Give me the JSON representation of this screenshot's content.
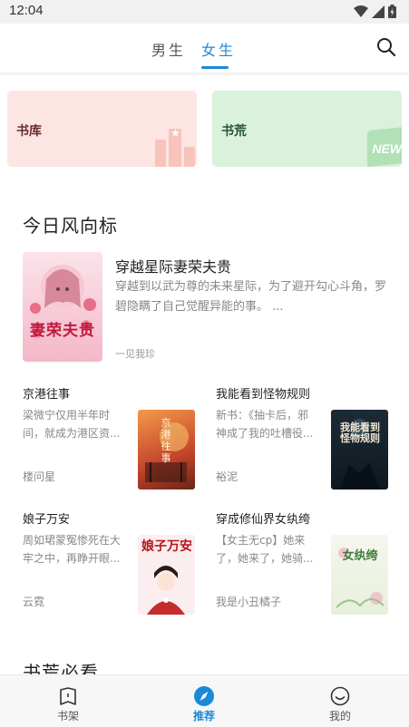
{
  "status_bar": {
    "time": "12:04"
  },
  "top_nav": {
    "tabs": [
      {
        "label": "男生",
        "active": false
      },
      {
        "label": "女生",
        "active": true
      }
    ],
    "accent_color": "#1a8ad8",
    "search_icon": "search-icon"
  },
  "categories": [
    {
      "label": "书库",
      "color": "#fde5e3"
    },
    {
      "label": "书荒",
      "color": "#daf1dc",
      "badge": "NEW"
    }
  ],
  "section_today": {
    "title": "今日风向标",
    "featured": {
      "title": "穿越星际妻荣夫贵",
      "description": "穿越到以武为尊的未来星际，为了避开勾心斗角，罗碧隐瞒了自己觉醒异能的事。 ...",
      "author": "一见我珍",
      "cover_text": "妻荣夫贵"
    },
    "books": [
      {
        "title": "京港往事",
        "description": "梁微宁仅用半年时间，就成为港区资...",
        "author": "楼问星",
        "cover_text": "京港往事"
      },
      {
        "title": "我能看到怪物规则",
        "description": "新书：《抽卡后，邪神成了我的吐槽役...",
        "author": "裕泥",
        "cover_text": "我能看到怪物规则"
      },
      {
        "title": "娘子万安",
        "description": "周如珺蒙冤惨死在大牢之中，再睁开眼...",
        "author": "云霓",
        "cover_text": "娘子万安"
      },
      {
        "title": "穿成修仙界女纨绔",
        "description": "【女主无cp】她来了，她来了，她骑...",
        "author": "我是小丑橘子",
        "cover_text": "女纨绔"
      }
    ]
  },
  "section_shortage": {
    "title": "书荒必看"
  },
  "bottom_nav": [
    {
      "label": "书架",
      "icon": "bookshelf-icon",
      "active": false
    },
    {
      "label": "推荐",
      "icon": "compass-icon",
      "active": true
    },
    {
      "label": "我的",
      "icon": "smiley-icon",
      "active": false
    }
  ]
}
